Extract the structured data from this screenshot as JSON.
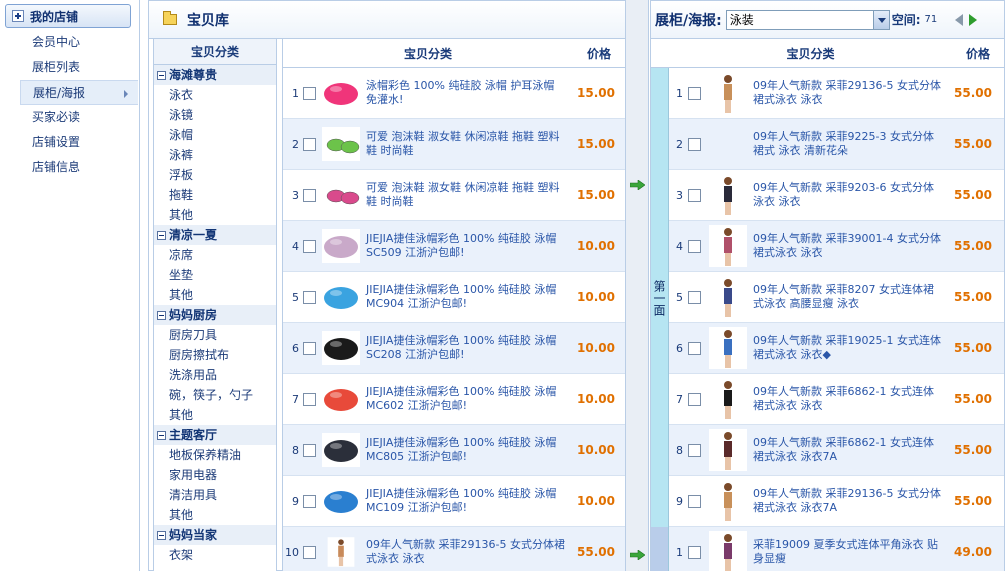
{
  "nav": {
    "title": "我的店铺",
    "items": [
      {
        "label": "会员中心"
      },
      {
        "label": "展柜列表"
      },
      {
        "label": "展柜/海报"
      },
      {
        "label": "买家必读"
      },
      {
        "label": "店铺设置"
      },
      {
        "label": "店铺信息"
      }
    ],
    "active_index": 2
  },
  "library": {
    "title": "宝贝库",
    "category_header": "宝贝分类",
    "categories": [
      {
        "type": "group",
        "label": "海滩尊贵"
      },
      {
        "type": "item",
        "label": "泳衣"
      },
      {
        "type": "item",
        "label": "泳镜"
      },
      {
        "type": "item",
        "label": "泳帽"
      },
      {
        "type": "item",
        "label": "泳裤"
      },
      {
        "type": "item",
        "label": "浮板"
      },
      {
        "type": "item",
        "label": "拖鞋"
      },
      {
        "type": "item",
        "label": "其他"
      },
      {
        "type": "group",
        "label": "清凉一夏"
      },
      {
        "type": "item",
        "label": "凉席"
      },
      {
        "type": "item",
        "label": "坐垫"
      },
      {
        "type": "item",
        "label": "其他"
      },
      {
        "type": "group",
        "label": "妈妈厨房"
      },
      {
        "type": "item",
        "label": "厨房刀具"
      },
      {
        "type": "item",
        "label": "厨房擦拭布"
      },
      {
        "type": "item",
        "label": "洗涤用品"
      },
      {
        "type": "item",
        "label": "碗，筷子，勺子"
      },
      {
        "type": "item",
        "label": "其他"
      },
      {
        "type": "group",
        "label": "主题客厅"
      },
      {
        "type": "item",
        "label": "地板保养精油"
      },
      {
        "type": "item",
        "label": "家用电器"
      },
      {
        "type": "item",
        "label": "清洁用具"
      },
      {
        "type": "item",
        "label": "其他"
      },
      {
        "type": "group",
        "label": "妈妈当家"
      },
      {
        "type": "item",
        "label": "衣架"
      }
    ],
    "table_header": {
      "category": "宝贝分类",
      "price": "价格"
    },
    "products": [
      {
        "num": "1",
        "title": "泳帽彩色 100% 纯硅胶 泳帽 护耳泳帽 免灌水!",
        "price": "15.00",
        "thumb": "pink-cap-icon",
        "color": "#f0357a"
      },
      {
        "num": "2",
        "title": "可爱 泡沫鞋 淑女鞋 休闲凉鞋 拖鞋 塑料鞋 时尚鞋",
        "price": "15.00",
        "thumb": "green-sandals-icon",
        "color": "#6cc34a"
      },
      {
        "num": "3",
        "title": "可爱 泡沫鞋 淑女鞋 休闲凉鞋 拖鞋 塑料鞋 时尚鞋",
        "price": "15.00",
        "thumb": "pink-sandals-icon",
        "color": "#d94a8c"
      },
      {
        "num": "4",
        "title": "JIEJIA捷佳泳帽彩色 100% 纯硅胶 泳帽 SC509 江浙沪包邮!",
        "price": "10.00",
        "thumb": "lilac-cap-icon",
        "color": "#c9a9c9"
      },
      {
        "num": "5",
        "title": "JIEJIA捷佳泳帽彩色 100% 纯硅胶 泳帽 MC904 江浙沪包邮!",
        "price": "10.00",
        "thumb": "blue-pink-cap-icon",
        "color": "#3aa3e0"
      },
      {
        "num": "6",
        "title": "JIEJIA捷佳泳帽彩色 100% 纯硅胶 泳帽 SC208 江浙沪包邮!",
        "price": "10.00",
        "thumb": "black-cap-icon",
        "color": "#1a1a1a"
      },
      {
        "num": "7",
        "title": "JIEJIA捷佳泳帽彩色 100% 纯硅胶 泳帽 MC602 江浙沪包邮!",
        "price": "10.00",
        "thumb": "rainbow-cap-icon",
        "color": "#e84a3a"
      },
      {
        "num": "8",
        "title": "JIEJIA捷佳泳帽彩色 100% 纯硅胶 泳帽 MC805 江浙沪包邮!",
        "price": "10.00",
        "thumb": "dark-cap-icon",
        "color": "#2b2f3a"
      },
      {
        "num": "9",
        "title": "JIEJIA捷佳泳帽彩色 100% 纯硅胶 泳帽 MC109 江浙沪包邮!",
        "price": "10.00",
        "thumb": "blue-cap-icon",
        "color": "#2a7fd0"
      },
      {
        "num": "10",
        "title": "09年人气新款 采菲29136-5 女式分体裙式泳衣 泳衣",
        "price": "55.00",
        "thumb": "swimsuit-icon",
        "color": "#c88a5a"
      }
    ]
  },
  "showcase": {
    "title": "展柜/海报:",
    "select_value": "泳装",
    "space_label": "空间:",
    "space_value": "71",
    "face_label": "第一面",
    "table_header": {
      "category": "宝贝分类",
      "price": "价格"
    },
    "rows": [
      {
        "num": "1",
        "title": "09年人气新款 采菲29136-5 女式分体裙式泳衣 泳衣",
        "price": "55.00",
        "has_thumb": true,
        "color": "#c8905a"
      },
      {
        "num": "2",
        "title": "09年人气新款 采菲9225-3 女式分体裙式 泳衣 清新花朵",
        "price": "55.00",
        "has_thumb": false,
        "color": "#ffffff"
      },
      {
        "num": "3",
        "title": "09年人气新款 采菲9203-6 女式分体泳衣 泳衣",
        "price": "55.00",
        "has_thumb": true,
        "color": "#2a2a3a"
      },
      {
        "num": "4",
        "title": "09年人气新款 采菲39001-4 女式分体裙式泳衣 泳衣",
        "price": "55.00",
        "has_thumb": true,
        "color": "#b0506a"
      },
      {
        "num": "5",
        "title": "09年人气新款 采菲8207 女式连体裙式泳衣 高腰显瘦 泳衣",
        "price": "55.00",
        "has_thumb": true,
        "color": "#3a4a8a"
      },
      {
        "num": "6",
        "title": "09年人气新款 采菲19025-1 女式连体裙式泳衣 泳衣◆",
        "price": "55.00",
        "has_thumb": true,
        "color": "#3a70c0"
      },
      {
        "num": "7",
        "title": "09年人气新款 采菲6862-1 女式连体裙式泳衣 泳衣",
        "price": "55.00",
        "has_thumb": true,
        "color": "#1a1a1a"
      },
      {
        "num": "8",
        "title": "09年人气新款 采菲6862-1 女式连体裙式泳衣 泳衣7A",
        "price": "55.00",
        "has_thumb": true,
        "color": "#5a2a2a"
      },
      {
        "num": "9",
        "title": "09年人气新款 采菲29136-5 女式分体裙式泳衣 泳衣7A",
        "price": "55.00",
        "has_thumb": true,
        "color": "#c8905a"
      },
      {
        "num": "1",
        "title": "采菲19009 夏季女式连体平角泳衣 贴身显瘦",
        "price": "49.00",
        "has_thumb": true,
        "color": "#7a3a6a"
      }
    ]
  },
  "colors": {
    "accent": "#1a3b7a",
    "price": "#e07000",
    "row_alt": "#eaf1fb",
    "border": "#b9cde6"
  }
}
